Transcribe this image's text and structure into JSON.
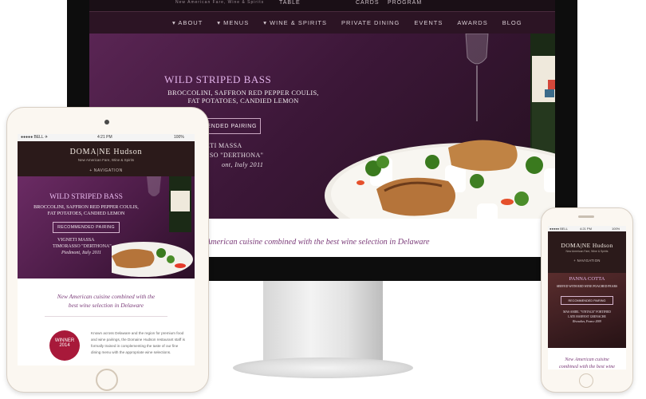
{
  "desktop": {
    "top_links": [
      "TABLE",
      "CARDS",
      "PROGRAM"
    ],
    "top_tagline": "New American Fare, Wine & Spirits",
    "nav": [
      "▾ ABOUT",
      "▾ MENUS",
      "▾ WINE & SPIRITS",
      "PRIVATE DINING",
      "EVENTS",
      "AWARDS",
      "BLOG"
    ],
    "hero": {
      "title": "WILD STRIPED BASS",
      "line1": "BROCCOLINI, SAFFRON RED PEPPER COULIS,",
      "line2": "FAT POTATOES, CANDIED LEMON",
      "button": "ENDED PAIRING",
      "wine1": "ETI MASSA",
      "wine2": "SSO \"DERTHONA\"",
      "wine3": "ont, Italy 2011"
    },
    "tagline": "American cuisine combined with the best wine selection in Delaware"
  },
  "tablet": {
    "status_left": "●●●●● BELL ✈",
    "status_center": "4:21 PM",
    "status_right": "100%",
    "logo": "DOMA|NE Hudson",
    "logo_sub": "New American Fare, Wine & Spirits",
    "nav": "+ NAVIGATION",
    "hero": {
      "title": "WILD STRIPED BASS",
      "line1": "BROCCOLINI, SAFFRON RED PEPPER COULIS,",
      "line2": "FAT POTATOES, CANDIED LEMON",
      "button": "RECOMMENDED PAIRING",
      "wine1": "VIGNETI MASSA",
      "wine2": "TIMORASSO \"DERTHONA\"",
      "wine3": "Piedmont, Italy 2011"
    },
    "tagline1": "New American cuisine combined with the",
    "tagline2": "best wine selection in Delaware",
    "badge": "WINNER 2014",
    "body": "Known across Delaware and the region for premium food and wine pairings, the Domaine Hudson restaurant staff is formally trained in complementing the taste of our fine dining menu with the appropriate wine selections."
  },
  "phone": {
    "status_left": "●●●●● BELL",
    "status_center": "4:21 PM",
    "status_right": "100%",
    "logo": "DOMA|NE Hudson",
    "logo_sub": "New American Fare, Wine & Spirits",
    "nav": "+ NAVIGATION",
    "hero": {
      "title": "PANNA COTTA",
      "line1": "SERVED WITH RED WINE POACHED PEARS",
      "button": "RECOMMENDED PAIRING",
      "wine1": "MAS AMIEL \"VINTAGE\" FORTIFIED",
      "wine2": "LATE HARVEST GRENACHE",
      "wine3": "Rivesaltes, France 2009"
    },
    "tagline1": "New American cuisine",
    "tagline2": "combined with the best wine"
  },
  "colors": {
    "accent": "#7a3a78",
    "hero_title": "#e2b3ea",
    "header_bg": "#2b1a1a",
    "badge": "#a8193a"
  }
}
